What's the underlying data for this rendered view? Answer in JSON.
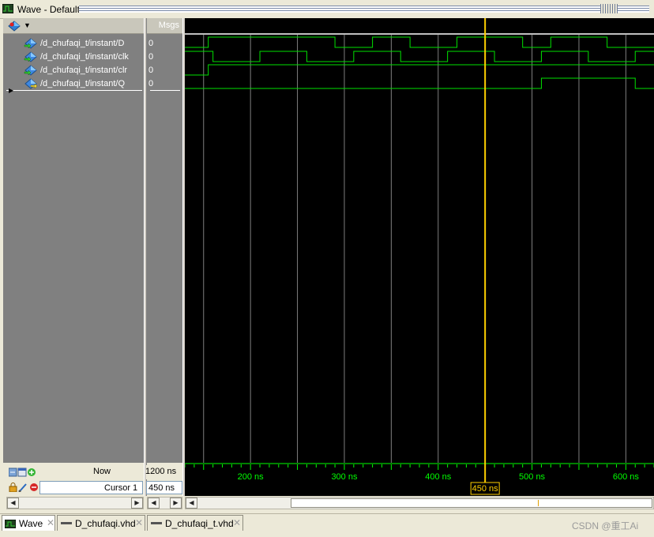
{
  "window": {
    "title": "Wave - Default"
  },
  "toolbar": {
    "add_icon": "add-wave-icon"
  },
  "headers": {
    "msgs": "Msgs"
  },
  "signals": [
    {
      "name": "/d_chufaqi_t/instant/D",
      "value": "0",
      "icon": "signal-in-icon"
    },
    {
      "name": "/d_chufaqi_t/instant/clk",
      "value": "0",
      "icon": "signal-in-icon"
    },
    {
      "name": "/d_chufaqi_t/instant/clr",
      "value": "0",
      "icon": "signal-in-icon"
    },
    {
      "name": "/d_chufaqi_t/instant/Q",
      "value": "0",
      "icon": "signal-out-icon"
    }
  ],
  "status": {
    "now_label": "Now",
    "now_value": "1200 ns",
    "cursor_label": "Cursor 1",
    "cursor_value": "450 ns"
  },
  "timeline": {
    "ticks": [
      "200 ns",
      "300 ns",
      "400 ns",
      "500 ns",
      "600 ns"
    ],
    "cursor_time_ns": 450,
    "view_start_ns": 130,
    "view_end_ns": 630
  },
  "waveforms": {
    "D": [
      [
        130,
        0
      ],
      [
        155,
        1
      ],
      [
        210,
        1
      ],
      [
        290,
        0
      ],
      [
        330,
        1
      ],
      [
        370,
        0
      ],
      [
        420,
        1
      ],
      [
        490,
        0
      ],
      [
        520,
        1
      ],
      [
        580,
        0
      ],
      [
        630,
        0
      ]
    ],
    "clk": [
      [
        130,
        1
      ],
      [
        160,
        0
      ],
      [
        210,
        1
      ],
      [
        260,
        0
      ],
      [
        310,
        1
      ],
      [
        360,
        0
      ],
      [
        410,
        1
      ],
      [
        460,
        0
      ],
      [
        510,
        1
      ],
      [
        560,
        0
      ],
      [
        610,
        1
      ],
      [
        630,
        1
      ]
    ],
    "clr": [
      [
        130,
        0
      ],
      [
        155,
        1
      ],
      [
        630,
        1
      ]
    ],
    "Q": [
      [
        130,
        0
      ],
      [
        510,
        1
      ],
      [
        610,
        0
      ],
      [
        630,
        0
      ]
    ]
  },
  "tabs": [
    {
      "label": "Wave",
      "active": true,
      "icon": "wave-window-icon"
    },
    {
      "label": "D_chufaqi.vhd",
      "active": false,
      "icon": "source-file-icon"
    },
    {
      "label": "D_chufaqi_t.vhd",
      "active": false,
      "icon": "source-file-icon"
    }
  ],
  "colors": {
    "wave": "#00e000",
    "grid": "#7f7f7f",
    "cursor": "#ffd000",
    "timeline_text": "#00ff00"
  },
  "watermark": "CSDN @重工Ai"
}
